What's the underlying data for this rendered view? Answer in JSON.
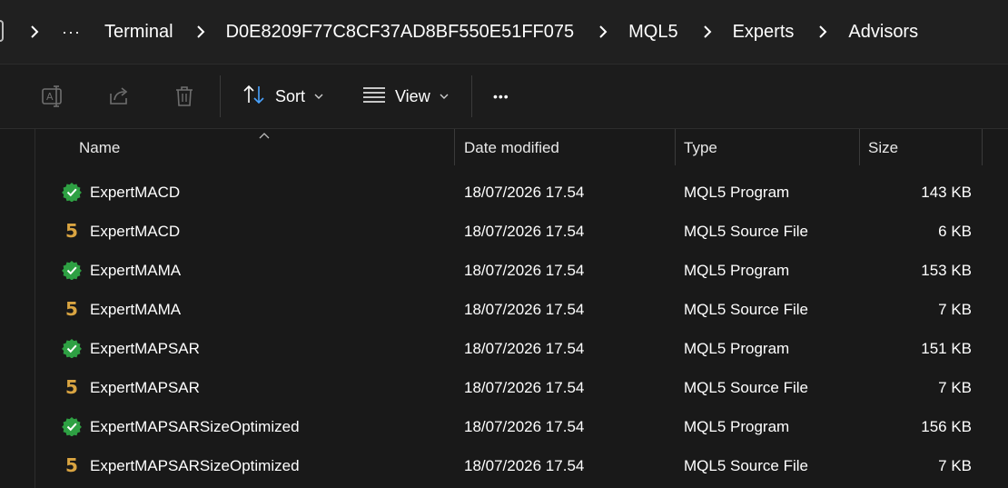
{
  "breadcrumb": {
    "ellipsis": "···",
    "segments": [
      "Terminal",
      "D0E8209F77C8CF37AD8BF550E51FF075",
      "MQL5",
      "Experts",
      "Advisors"
    ]
  },
  "toolbar": {
    "sort_label": "Sort",
    "view_label": "View",
    "more_label": "•••"
  },
  "columns": {
    "name": "Name",
    "date": "Date modified",
    "type": "Type",
    "size": "Size"
  },
  "files": [
    {
      "name": "ExpertMACD",
      "date": "18/07/2026 17.54",
      "type": "MQL5 Program",
      "size": "143 KB",
      "icon": "program-icon"
    },
    {
      "name": "ExpertMACD",
      "date": "18/07/2026 17.54",
      "type": "MQL5 Source File",
      "size": "6 KB",
      "icon": "source-icon"
    },
    {
      "name": "ExpertMAMA",
      "date": "18/07/2026 17.54",
      "type": "MQL5 Program",
      "size": "153 KB",
      "icon": "program-icon"
    },
    {
      "name": "ExpertMAMA",
      "date": "18/07/2026 17.54",
      "type": "MQL5 Source File",
      "size": "7 KB",
      "icon": "source-icon"
    },
    {
      "name": "ExpertMAPSAR",
      "date": "18/07/2026 17.54",
      "type": "MQL5 Program",
      "size": "151 KB",
      "icon": "program-icon"
    },
    {
      "name": "ExpertMAPSAR",
      "date": "18/07/2026 17.54",
      "type": "MQL5 Source File",
      "size": "7 KB",
      "icon": "source-icon"
    },
    {
      "name": "ExpertMAPSARSizeOptimized",
      "date": "18/07/2026 17.54",
      "type": "MQL5 Program",
      "size": "156 KB",
      "icon": "program-icon"
    },
    {
      "name": "ExpertMAPSARSizeOptimized",
      "date": "18/07/2026 17.54",
      "type": "MQL5 Source File",
      "size": "7 KB",
      "icon": "source-icon"
    }
  ],
  "source_icon_glyph": "5",
  "colors": {
    "background": "#191919",
    "program_icon": "#2ea043",
    "source_icon": "#d9a441",
    "sort_arrow_accent": "#4aa3ff"
  }
}
